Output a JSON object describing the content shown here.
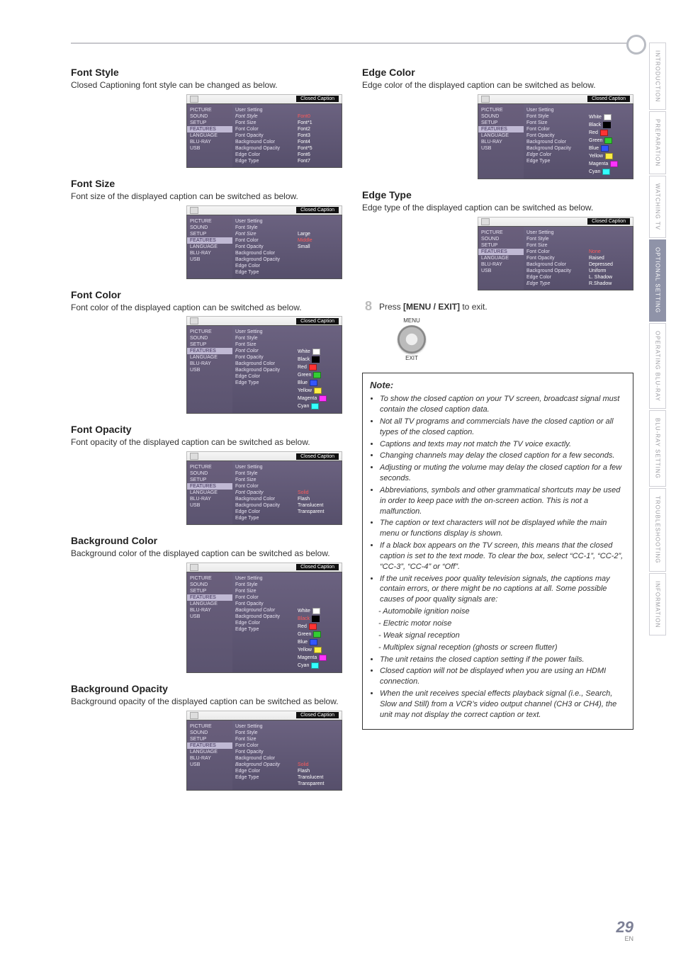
{
  "pageNumber": "29",
  "pageLang": "EN",
  "topLabels": {
    "closedCaption": "Closed Caption"
  },
  "sideMenu": {
    "items": [
      "PICTURE",
      "SOUND",
      "SETUP",
      "FEATURES",
      "LANGUAGE",
      "BLU-RAY",
      "USB"
    ]
  },
  "settingLabels": {
    "userSetting": "User Setting",
    "fontStyle": "Font Style",
    "fontSize": "Font Size",
    "fontColor": "Font Color",
    "fontOpacity": "Font Opacity",
    "backgroundColor": "Background Color",
    "backgroundOpacity": "Background Opacity",
    "edgeColor": "Edge Color",
    "edgeType": "Edge Type"
  },
  "sections": {
    "fontStyle": {
      "title": "Font Style",
      "desc": "Closed Captioning font style can be changed as below.",
      "highlight": "fontStyle",
      "values": [
        "Font0",
        "Font*1",
        "Font2",
        "Font3",
        "Font4",
        "Font*5",
        "Font6",
        "Font7"
      ]
    },
    "fontSize": {
      "title": "Font Size",
      "desc": "Font size of the displayed caption can be switched as below.",
      "highlight": "fontSize",
      "values": [
        "Large",
        "Middle",
        "Small"
      ]
    },
    "fontColor": {
      "title": "Font Color",
      "desc": "Font color of the displayed caption can be switched as below.",
      "highlight": "fontColor",
      "values": [
        "White",
        "Black",
        "Red",
        "Green",
        "Blue",
        "Yellow",
        "Magenta",
        "Cyan"
      ],
      "swatches": [
        "#fff",
        "#000",
        "#f33",
        "#3c3",
        "#35f",
        "#fe4",
        "#f3f",
        "#3ff"
      ]
    },
    "fontOpacity": {
      "title": "Font Opacity",
      "desc": "Font opacity of the displayed caption can be switched as below.",
      "highlight": "fontOpacity",
      "values": [
        "Solid",
        "Flash",
        "Translucent",
        "Transparent"
      ]
    },
    "bgColor": {
      "title": "Background Color",
      "desc": "Background color of the displayed caption can be switched as below.",
      "highlight": "backgroundColor",
      "values": [
        "White",
        "Black",
        "Red",
        "Green",
        "Blue",
        "Yellow",
        "Magenta",
        "Cyan"
      ],
      "swatches": [
        "#fff",
        "#000",
        "#f33",
        "#3c3",
        "#35f",
        "#fe4",
        "#f3f",
        "#3ff"
      ]
    },
    "bgOpacity": {
      "title": "Background Opacity",
      "desc": "Background opacity of the displayed caption can be switched as below.",
      "highlight": "backgroundOpacity",
      "values": [
        "Solid",
        "Flash",
        "Translucent",
        "Transparent"
      ]
    },
    "edgeColor": {
      "title": "Edge Color",
      "desc": "Edge color of the displayed caption can be switched as below.",
      "highlight": "edgeColor",
      "values": [
        "White",
        "Black",
        "Red",
        "Green",
        "Blue",
        "Yellow",
        "Magenta",
        "Cyan"
      ],
      "swatches": [
        "#fff",
        "#000",
        "#f33",
        "#3c3",
        "#35f",
        "#fe4",
        "#f3f",
        "#3ff"
      ],
      "startAt": 1
    },
    "edgeType": {
      "title": "Edge Type",
      "desc": "Edge type of the displayed caption can be switched as below.",
      "highlight": "edgeType",
      "values": [
        "None",
        "Raised",
        "Depressed",
        "Uniform",
        "L. Shadow",
        "R.Shadow"
      ],
      "startAt": 3
    }
  },
  "step": {
    "num": "8",
    "textA": "Press ",
    "textB": "[MENU / EXIT]",
    "textC": " to exit.",
    "menuLabel": "MENU",
    "exitLabel": "EXIT"
  },
  "note": {
    "title": "Note:",
    "items": [
      "To show the closed caption on your TV screen, broadcast signal must contain the closed caption data.",
      "Not all TV programs and commercials have the closed caption or all types of the closed caption.",
      "Captions and texts may not match the TV voice exactly.",
      "Changing channels may delay the closed caption for a few seconds.",
      "Adjusting or muting the volume may delay the closed caption for a few seconds.",
      "Abbreviations, symbols and other grammatical shortcuts may be used in order to keep pace with the on-screen action. This is not a malfunction.",
      "The caption or text characters will not be displayed while the main menu or functions display is shown.",
      "If a black box appears on the TV screen, this means that the closed caption is set to the text mode. To clear the box, select “CC-1”, “CC-2”, “CC-3”, “CC-4” or “Off”.",
      "If the unit receives poor quality television signals, the captions may contain errors, or there might be no captions at all. Some possible causes of poor quality signals are:"
    ],
    "subs": [
      "- Automobile ignition noise",
      "- Electric motor noise",
      "- Weak signal reception",
      "- Multiplex signal reception (ghosts or screen flutter)"
    ],
    "tail": [
      "The unit retains the closed caption setting if the power fails.",
      "Closed caption will not be displayed when you are using an HDMI connection.",
      "When the unit receives special effects playback signal (i.e., Search, Slow and Still) from a VCR’s video output channel (CH3 or CH4), the unit may not display the correct caption or text."
    ]
  },
  "sidetabs": [
    {
      "label": "INTRODUCTION",
      "active": false
    },
    {
      "label": "PREPARATION",
      "active": false
    },
    {
      "label": "WATCHING  TV",
      "active": false
    },
    {
      "label": "OPTIONAL  SETTING",
      "active": true
    },
    {
      "label": "OPERATING  BLU-RAY",
      "active": false
    },
    {
      "label": "BLU-RAY  SETTING",
      "active": false
    },
    {
      "label": "TROUBLESHOOTING",
      "active": false
    },
    {
      "label": "INFORMATION",
      "active": false
    }
  ]
}
